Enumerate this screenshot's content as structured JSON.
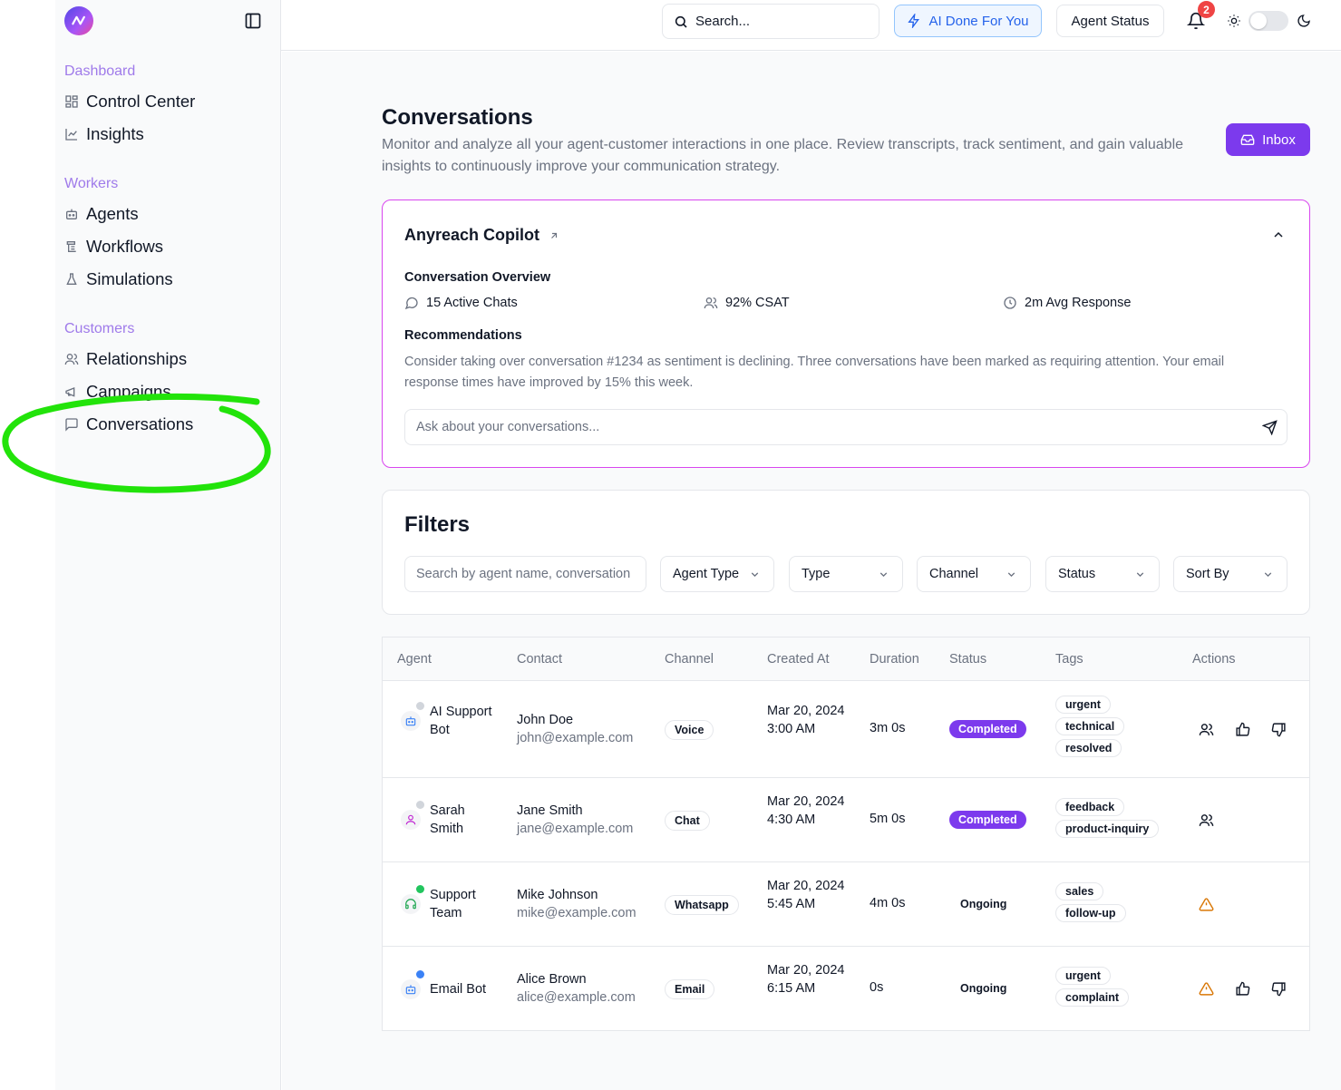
{
  "sidebar": {
    "sections": [
      {
        "title": "Dashboard",
        "items": [
          {
            "label": "Control Center",
            "icon": "grid-icon"
          },
          {
            "label": "Insights",
            "icon": "chart-line-icon"
          }
        ]
      },
      {
        "title": "Workers",
        "items": [
          {
            "label": "Agents",
            "icon": "bot-icon"
          },
          {
            "label": "Workflows",
            "icon": "workflow-icon"
          },
          {
            "label": "Simulations",
            "icon": "flask-icon"
          }
        ]
      },
      {
        "title": "Customers",
        "items": [
          {
            "label": "Relationships",
            "icon": "users-icon"
          },
          {
            "label": "Campaigns",
            "icon": "megaphone-icon"
          },
          {
            "label": "Conversations",
            "icon": "message-square-icon"
          }
        ]
      }
    ]
  },
  "header": {
    "search_placeholder": "Search...",
    "ai_button": "AI Done For You",
    "agent_status_button": "Agent Status",
    "notification_count": "2"
  },
  "page": {
    "title": "Conversations",
    "description": "Monitor and analyze all your agent-customer interactions in one place. Review transcripts, track sentiment, and gain valuable insights to continuously improve your communication strategy.",
    "inbox_button": "Inbox"
  },
  "copilot": {
    "title": "Anyreach Copilot",
    "overview_label": "Conversation Overview",
    "stats": {
      "active_chats": "15 Active Chats",
      "csat": "92% CSAT",
      "avg_response": "2m Avg Response"
    },
    "recommendations_label": "Recommendations",
    "recommendations_text": "Consider taking over conversation #1234 as sentiment is declining. Three conversations have been marked as requiring attention. Your email response times have improved by 15% this week.",
    "ask_placeholder": "Ask about your conversations..."
  },
  "filters": {
    "title": "Filters",
    "search_placeholder": "Search by agent name, conversation",
    "selects": [
      "Agent Type",
      "Type",
      "Channel",
      "Status",
      "Sort By"
    ]
  },
  "table": {
    "headers": [
      "Agent",
      "Contact",
      "Channel",
      "Created At",
      "Duration",
      "Status",
      "Tags",
      "Actions"
    ],
    "rows": [
      {
        "agent": "AI Support Bot",
        "agent_icon": "bot-icon",
        "dot_color": "#d1d5db",
        "contact_name": "John Doe",
        "contact_email": "john@example.com",
        "channel": "Voice",
        "created": "Mar 20, 2024 3:00 AM",
        "duration": "3m 0s",
        "status": "Completed",
        "tags": [
          "urgent",
          "technical",
          "resolved"
        ],
        "actions": [
          "users-icon",
          "thumbs-up-icon",
          "thumbs-down-icon"
        ]
      },
      {
        "agent": "Sarah Smith",
        "agent_icon": "user-icon",
        "dot_color": "#d1d5db",
        "contact_name": "Jane Smith",
        "contact_email": "jane@example.com",
        "channel": "Chat",
        "created": "Mar 20, 2024 4:30 AM",
        "duration": "5m 0s",
        "status": "Completed",
        "tags": [
          "feedback",
          "product-inquiry"
        ],
        "actions": [
          "users-icon"
        ]
      },
      {
        "agent": "Support Team",
        "agent_icon": "headset-icon",
        "dot_color": "#22c55e",
        "contact_name": "Mike Johnson",
        "contact_email": "mike@example.com",
        "channel": "Whatsapp",
        "created": "Mar 20, 2024 5:45 AM",
        "duration": "4m 0s",
        "status": "Ongoing",
        "tags": [
          "sales",
          "follow-up"
        ],
        "actions": [
          "warning-icon"
        ]
      },
      {
        "agent": "Email Bot",
        "agent_icon": "bot-icon",
        "dot_color": "#3b82f6",
        "contact_name": "Alice Brown",
        "contact_email": "alice@example.com",
        "channel": "Email",
        "created": "Mar 20, 2024 6:15 AM",
        "duration": "0s",
        "status": "Ongoing",
        "tags": [
          "urgent",
          "complaint"
        ],
        "actions": [
          "warning-icon",
          "thumbs-up-icon",
          "thumbs-down-icon"
        ]
      }
    ]
  }
}
